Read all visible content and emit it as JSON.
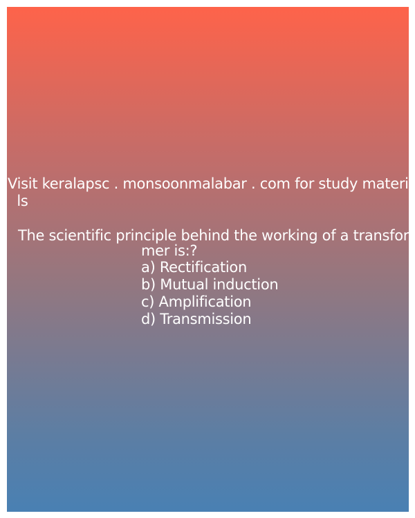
{
  "site_text": {
    "line1": "Visit keralapsc . monsoonmalabar . com for study materia",
    "line2": " ls"
  },
  "question": {
    "line1": "The scientific principle behind the working of a transfor",
    "line2": "mer is:?"
  },
  "options": {
    "a": "a) Rectification",
    "b": "b) Mutual induction",
    "c": "c) Amplification",
    "d": "d) Transmission"
  },
  "colors": {
    "gradient_top": "#fe634a",
    "gradient_bottom": "#4980b3",
    "text": "#ffffff"
  }
}
